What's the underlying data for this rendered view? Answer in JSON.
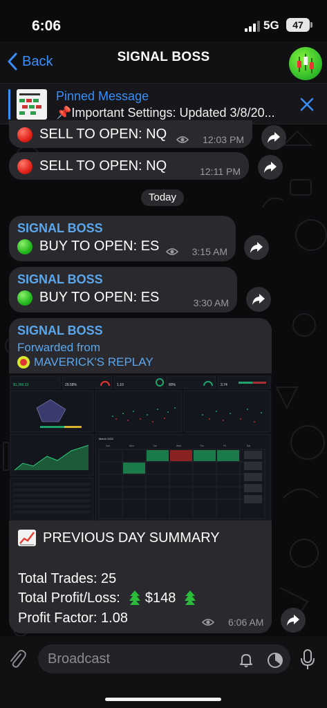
{
  "status_bar": {
    "time": "6:06",
    "network": "5G",
    "battery": "47"
  },
  "header": {
    "back_label": "Back",
    "title": "SIGNAL BOSS"
  },
  "pinned": {
    "title": "Pinned Message",
    "text": "📌Important Settings: Updated 3/8/20..."
  },
  "messages": [
    {
      "text": "SELL TO OPEN: NQ",
      "time": "12:03 PM",
      "dot": "red"
    },
    {
      "text": "SELL TO OPEN: NQ",
      "time": "12:11 PM",
      "dot": "red"
    }
  ],
  "date_separator": "Today",
  "today_messages": [
    {
      "sender": "SIGNAL BOSS",
      "text": "BUY TO OPEN: ES",
      "time": "3:15 AM",
      "dot": "green"
    },
    {
      "sender": "SIGNAL BOSS",
      "text": "BUY TO OPEN: ES",
      "time": "3:30 AM",
      "dot": "green"
    }
  ],
  "summary_message": {
    "sender": "SIGNAL BOSS",
    "forwarded_label": "Forwarded from",
    "forwarded_channel": "MAVERICK'S REPLAY",
    "title": "PREVIOUS DAY SUMMARY",
    "total_trades": "Total Trades: 25",
    "profit_loss_label": "Total Profit/Loss:",
    "profit_loss_value": "$148",
    "profit_factor": "Profit Factor: 1.08",
    "time": "6:06 AM",
    "dashboard": {
      "stat1": "$1,366.33",
      "stat2": "29.58%",
      "stat3": "1.10",
      "stat4": "80%",
      "stat5": "3.74",
      "month": "March 2022",
      "weekdays": [
        "Sun",
        "Mon",
        "Tue",
        "Wed",
        "Thu",
        "Fri",
        "Sat"
      ]
    }
  },
  "composer": {
    "placeholder": "Broadcast"
  },
  "colors": {
    "accent": "#3a8ef7",
    "sender": "#5aa7ee",
    "bubble": "#2a2a2e",
    "profit_green": "#1fa36a",
    "loss_red": "#a83232"
  }
}
